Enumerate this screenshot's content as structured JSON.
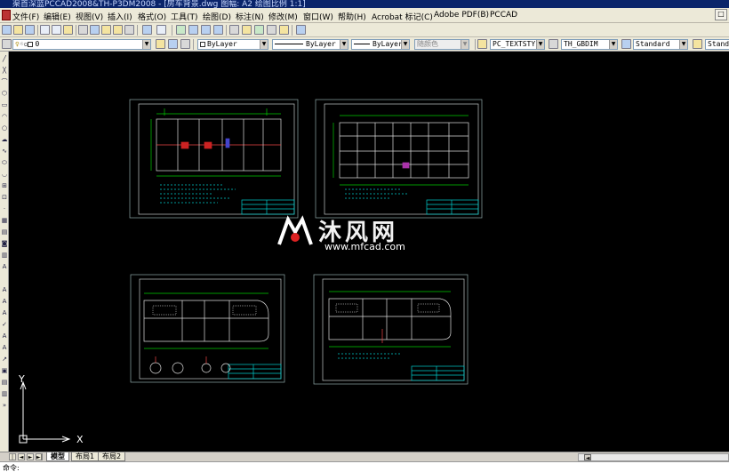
{
  "window": {
    "title": "渠首深蓝PCCAD2008&TH-P3DM2008 - [房车背景.dwg 图幅: A2 绘图比例 1:1]"
  },
  "menubar": {
    "items": [
      "文件(F)",
      "编辑(E)",
      "视图(V)",
      "插入(I)",
      "格式(O)",
      "工具(T)",
      "绘图(D)",
      "标注(N)",
      "修改(M)",
      "窗口(W)",
      "帮助(H)",
      "Acrobat 标记(C)",
      "Adobe PDF(B)",
      "PCCAD"
    ],
    "restore_label": "□"
  },
  "layers_toolbar": {
    "layer_value": "0",
    "color_value": "ByLayer",
    "linetype_value": "ByLayer",
    "lineweight_value": "ByLayer",
    "plotstyle_value": "随颜色"
  },
  "styles_toolbar": {
    "text_style": "PC_TEXTSTY",
    "dim_style": "TH_GBDIM",
    "table_style": "Standard",
    "extra_style": "Stand"
  },
  "canvas": {
    "background": "#000000",
    "ucs_x_label": "X",
    "ucs_y_label": "Y"
  },
  "watermark": {
    "logo_text": "沐风网",
    "url": "www.mfcad.com"
  },
  "layout_tabs": {
    "nav": [
      "|◄",
      "◄",
      "►",
      "►|"
    ],
    "tabs": [
      "模型",
      "布局1",
      "布局2"
    ],
    "active": "模型",
    "scroll_arrow": "◄"
  },
  "command_line": {
    "text": "命令:"
  }
}
